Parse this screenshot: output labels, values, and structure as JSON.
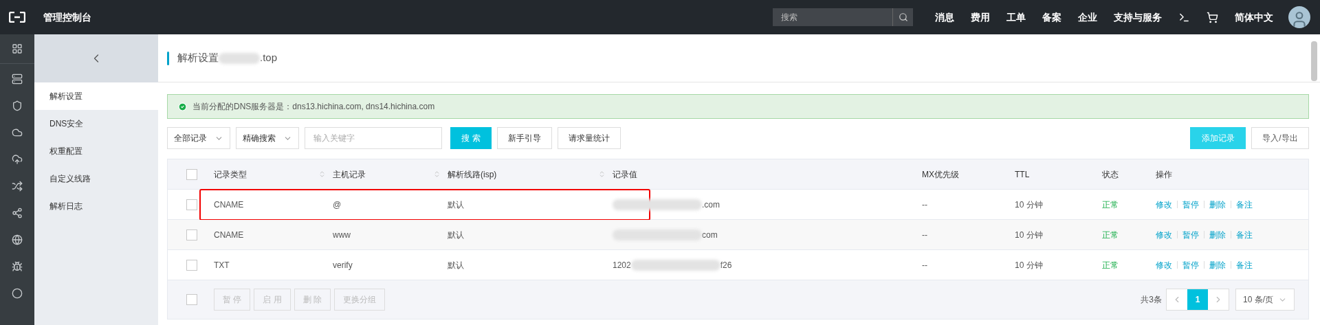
{
  "topbar": {
    "title": "管理控制台",
    "search": {
      "placeholder": "搜索"
    },
    "nav": [
      "消息",
      "费用",
      "工单",
      "备案",
      "企业",
      "支持与服务"
    ],
    "language": "简体中文"
  },
  "sidebar": {
    "items": [
      {
        "label": "解析设置",
        "selected": true
      },
      {
        "label": "DNS安全",
        "selected": false
      },
      {
        "label": "权重配置",
        "selected": false
      },
      {
        "label": "自定义线路",
        "selected": false
      },
      {
        "label": "解析日志",
        "selected": false
      }
    ]
  },
  "header": {
    "title_parts": [
      {
        "kind": "text",
        "text": "解析设置"
      },
      {
        "kind": "blur"
      },
      {
        "kind": "text",
        "text": ".top"
      }
    ]
  },
  "alert": {
    "text": "当前分配的DNS服务器是：dns13.hichina.com, dns14.hichina.com"
  },
  "toolbar": {
    "filter": "全部记录",
    "search_type": "精确搜索",
    "keyword": {
      "placeholder": "输入关键字"
    },
    "search_button": "搜 索",
    "buttons": [
      "新手引导",
      "请求量统计"
    ],
    "add_button": "添加记录",
    "import_export_button": "导入/导出"
  },
  "table": {
    "select_all_checked": false,
    "columns": [
      {
        "label": "记录类型",
        "kind": "sortable"
      },
      {
        "label": "主机记录",
        "kind": "sortable"
      },
      {
        "label": "解析线路(isp)",
        "kind": "sortable"
      },
      {
        "label": "记录值",
        "kind": "plain"
      },
      {
        "label": "MX优先级",
        "kind": "plain"
      },
      {
        "label": "TTL",
        "kind": "plain"
      },
      {
        "label": "状态",
        "kind": "plain"
      },
      {
        "label": "操作",
        "kind": "plain"
      }
    ],
    "rows": [
      {
        "checked": false,
        "highlighted": true,
        "type": "CNAME",
        "host": "@",
        "line": "默认",
        "value_parts": [
          {
            "kind": "blur"
          },
          {
            "kind": "text",
            "text": ".com"
          }
        ],
        "mx": "--",
        "ttl": "10 分钟",
        "status": "正常",
        "actions": [
          "修改",
          "暂停",
          "删除",
          "备注"
        ]
      },
      {
        "checked": false,
        "highlighted": false,
        "type": "CNAME",
        "host": "www",
        "line": "默认",
        "value_parts": [
          {
            "kind": "blur"
          },
          {
            "kind": "text",
            "text": "com"
          }
        ],
        "mx": "--",
        "ttl": "10 分钟",
        "status": "正常",
        "actions": [
          "修改",
          "暂停",
          "删除",
          "备注"
        ]
      },
      {
        "checked": false,
        "highlighted": false,
        "type": "TXT",
        "host": "verify",
        "line": "默认",
        "value_parts": [
          {
            "kind": "text",
            "text": "1202"
          },
          {
            "kind": "blur"
          },
          {
            "kind": "text",
            "text": "f26"
          }
        ],
        "mx": "--",
        "ttl": "10 分钟",
        "status": "正常",
        "actions": [
          "修改",
          "暂停",
          "删除",
          "备注"
        ]
      }
    ],
    "footer": {
      "checked": false,
      "bulk_buttons": [
        {
          "label": "暂 停",
          "disabled": true
        },
        {
          "label": "启 用",
          "disabled": true
        },
        {
          "label": "删 除",
          "disabled": true
        },
        {
          "label": "更换分组",
          "disabled": true
        }
      ],
      "total": "共3条",
      "pages": [
        {
          "label": "1",
          "selected": true
        }
      ],
      "page_size": "10 条/页"
    }
  }
}
